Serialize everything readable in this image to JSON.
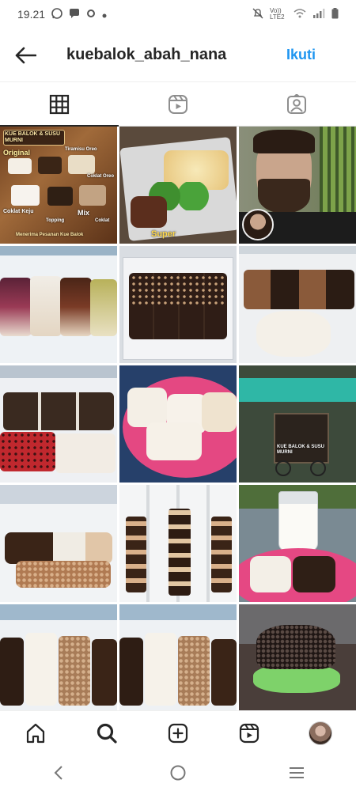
{
  "status_bar": {
    "time": "19.21",
    "network": "Vo)) LTE2"
  },
  "header": {
    "username": "kuebalok_abah_nana",
    "follow_label": "Ikuti"
  },
  "tabs": [
    {
      "name": "grid-tab",
      "icon": "grid-icon"
    },
    {
      "name": "reels-tab",
      "icon": "reels-icon"
    },
    {
      "name": "tagged-tab",
      "icon": "tagged-icon"
    }
  ],
  "posts": {
    "post1_title": "KUE BALOK & SUSU MURNI",
    "post1_labels": [
      "Original",
      "Tiramisu Oreo",
      "Coklat Oreo",
      "Coklat Keju",
      "Mix",
      "Topping",
      "Coklat"
    ],
    "post1_footer": "Menerima Pesanan Kue Balok",
    "post2_label": "Super",
    "post12_sign": "KUE BALOK & SUSU MURNI"
  },
  "bottom_nav": [
    "home-icon",
    "search-icon",
    "create-icon",
    "reels-icon",
    "profile-avatar"
  ],
  "colors": {
    "accent": "#1e95f0",
    "text": "#262626"
  }
}
